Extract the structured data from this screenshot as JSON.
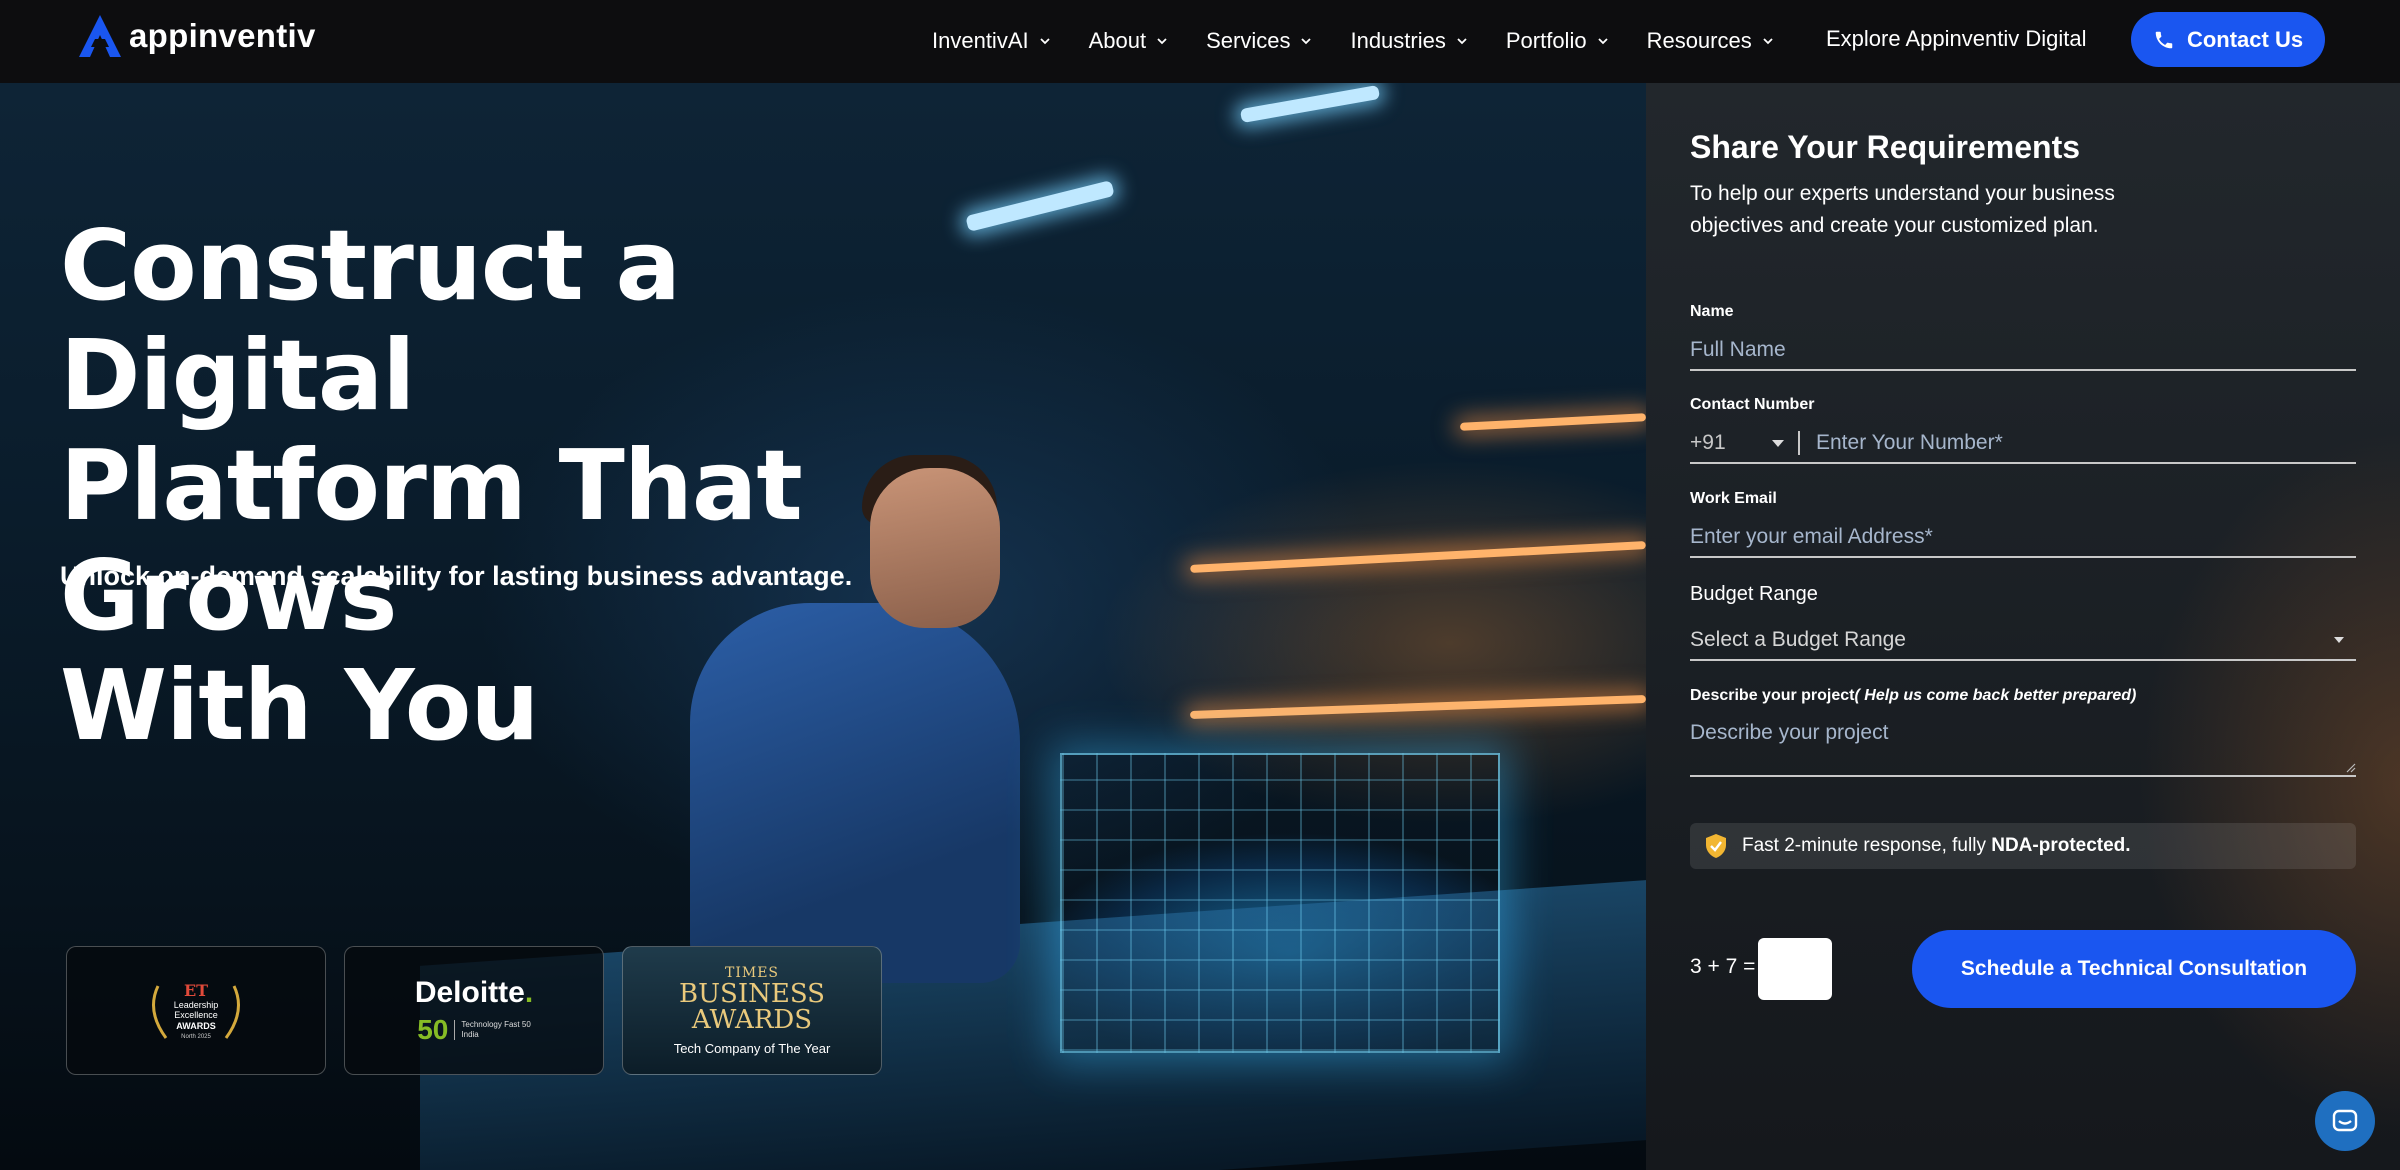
{
  "brand": {
    "name": "appinventiv"
  },
  "nav": {
    "items": [
      {
        "label": "InventivAI"
      },
      {
        "label": "About"
      },
      {
        "label": "Services"
      },
      {
        "label": "Industries"
      },
      {
        "label": "Portfolio"
      },
      {
        "label": "Resources"
      }
    ],
    "explore": "Explore Appinventiv Digital",
    "contact": "Contact Us"
  },
  "hero": {
    "headline_lines": [
      "Construct a Digital",
      "Platform That Grows",
      "With You"
    ],
    "subheadline": "Unlock on-demand scalability for lasting business advantage."
  },
  "awards": {
    "deloitte": {
      "name": "Deloitte",
      "dot": ".",
      "number": "50",
      "tag_line1": "Technology Fast 50",
      "tag_line2": "India"
    },
    "times": {
      "top": "TIMES",
      "line1": "BUSINESS",
      "line2": "AWARDS",
      "sub": "Tech Company of The Year"
    },
    "et": {
      "line1": "ET",
      "line2": "Leadership",
      "line3": "Excellence",
      "line4": "AWARDS",
      "line5": "North 2025"
    }
  },
  "form": {
    "title": "Share Your Requirements",
    "description": "To help our experts understand your business objectives and create your customized plan.",
    "name": {
      "label": "Name",
      "placeholder": "Full Name"
    },
    "contact": {
      "label": "Contact Number",
      "country_code": "+91",
      "placeholder": "Enter Your Number*"
    },
    "email": {
      "label": "Work Email",
      "placeholder": "Enter your email Address*"
    },
    "budget": {
      "label": "Budget Range",
      "selected": "Select a Budget Range"
    },
    "project": {
      "label": "Describe your project",
      "label_hint": "( Help us come back better prepared)",
      "placeholder": "Describe your project"
    },
    "nda_prefix": "Fast 2-minute response, fully ",
    "nda_bold": "NDA-protected.",
    "captcha": "3 + 7 =",
    "submit": "Schedule a Technical Consultation"
  },
  "colors": {
    "accent": "#1a56f0",
    "deloitte_green": "#86bc25",
    "gold": "#e9c97c"
  }
}
